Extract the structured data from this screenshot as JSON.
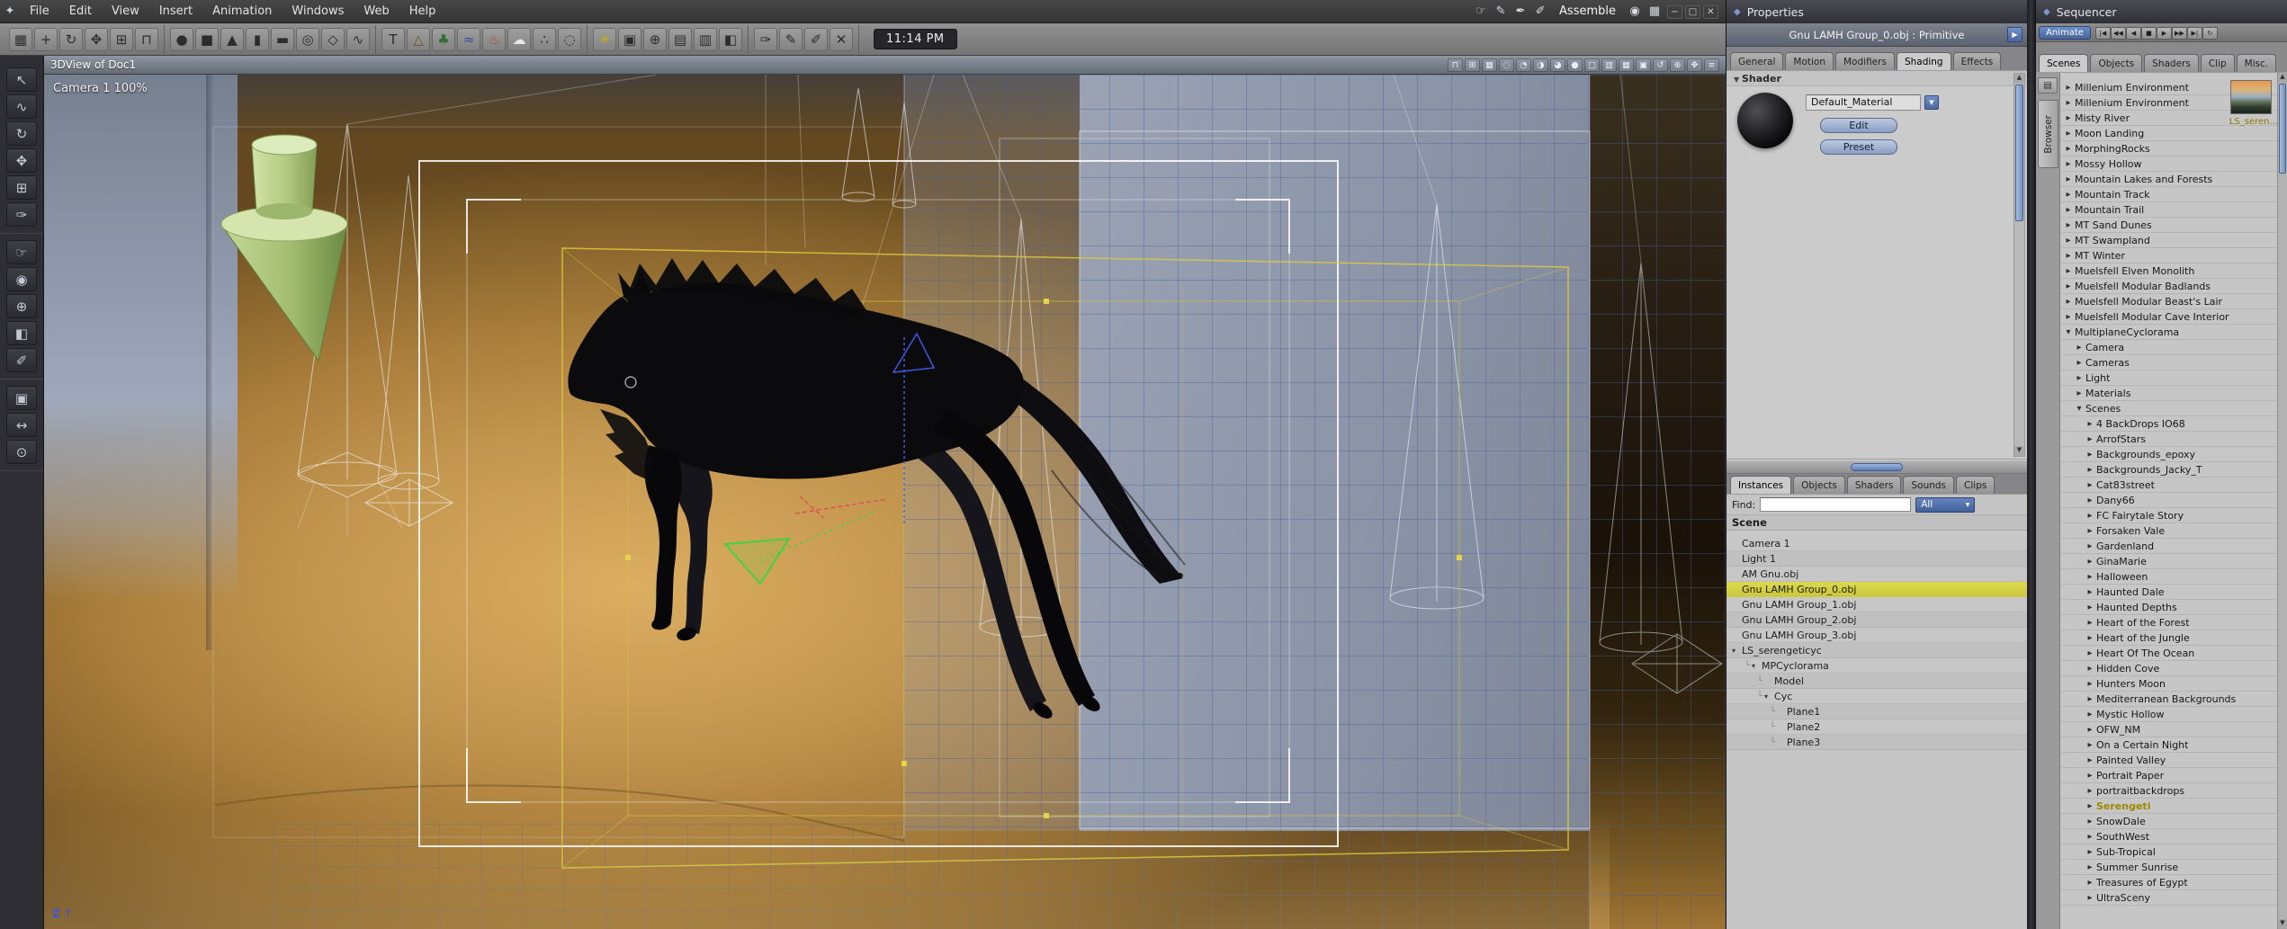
{
  "colors": {
    "accent_blue": "#4a66a0",
    "selection_yellow": "#d5d145",
    "backdrop_orange": "#c2954e",
    "wall_blue": "#8a92a6",
    "highlight_text_yellow": "#9c8a00"
  },
  "menu": {
    "items": [
      "File",
      "Edit",
      "View",
      "Insert",
      "Animation",
      "Windows",
      "Web",
      "Help"
    ],
    "mode_label": "Assemble",
    "left_icons": [
      {
        "name": "app-logo-icon",
        "glyph": "✦"
      }
    ],
    "right_icons": [
      {
        "name": "hand-mode-icon",
        "glyph": "☞"
      },
      {
        "name": "pencil-mode-icon",
        "glyph": "✎"
      },
      {
        "name": "pen-mode-icon",
        "glyph": "✒"
      },
      {
        "name": "brush-mode-icon",
        "glyph": "✐"
      }
    ],
    "right_icons2": [
      {
        "name": "visibility-icon",
        "glyph": "◉"
      },
      {
        "name": "layout-icon",
        "glyph": "▦"
      }
    ],
    "window_controls": [
      {
        "name": "minimize-button",
        "glyph": "−"
      },
      {
        "name": "maximize-button",
        "glyph": "□"
      },
      {
        "name": "close-button",
        "glyph": "✕"
      }
    ]
  },
  "toolbar": {
    "time": "11:14 PM",
    "groups": [
      [
        {
          "name": "grid-plane-icon",
          "glyph": "▦"
        },
        {
          "name": "axes-icon",
          "glyph": "+"
        },
        {
          "name": "rotate-icon",
          "glyph": "↻"
        },
        {
          "name": "move-icon",
          "glyph": "✥"
        },
        {
          "name": "scale-icon",
          "glyph": "⊞"
        },
        {
          "name": "magnet-icon",
          "glyph": "⊓"
        }
      ],
      [
        {
          "name": "insert-sphere-icon",
          "glyph": "●"
        },
        {
          "name": "insert-cube-icon",
          "glyph": "■"
        },
        {
          "name": "insert-cone-icon",
          "glyph": "▲"
        },
        {
          "name": "insert-cylinder-icon",
          "glyph": "▮"
        },
        {
          "name": "insert-plane-icon",
          "glyph": "▬"
        },
        {
          "name": "insert-torus-icon",
          "glyph": "◎"
        },
        {
          "name": "insert-vertex-object-icon",
          "glyph": "◇"
        },
        {
          "name": "insert-spline-object-icon",
          "glyph": "∿"
        }
      ],
      [
        {
          "name": "insert-text-icon",
          "glyph": "T"
        },
        {
          "name": "insert-terrain-icon",
          "glyph": "△",
          "color": "#6e5428"
        },
        {
          "name": "insert-plant-icon",
          "glyph": "♣",
          "color": "#2e6e2e"
        },
        {
          "name": "insert-ocean-icon",
          "glyph": "≈",
          "color": "#2e4e9e"
        },
        {
          "name": "insert-fire-icon",
          "glyph": "♨",
          "color": "#b04a1a"
        },
        {
          "name": "insert-cloud-icon",
          "glyph": "☁",
          "color": "#e8e8e8"
        },
        {
          "name": "insert-particles-icon",
          "glyph": "∴"
        },
        {
          "name": "insert-metaball-icon",
          "glyph": "◌"
        }
      ],
      [
        {
          "name": "insert-light-icon",
          "glyph": "☀",
          "color": "#c8a818"
        },
        {
          "name": "insert-camera-icon",
          "glyph": "▣"
        },
        {
          "name": "insert-target-icon",
          "glyph": "⊕"
        },
        {
          "name": "group-icon",
          "glyph": "▤"
        },
        {
          "name": "ungroup-icon",
          "glyph": "▥"
        },
        {
          "name": "render-icon",
          "glyph": "◧"
        }
      ],
      [
        {
          "name": "eyedropper-icon",
          "glyph": "✑"
        },
        {
          "name": "pencil-icon",
          "glyph": "✎"
        },
        {
          "name": "brush-icon",
          "glyph": "✐"
        },
        {
          "name": "delete-icon",
          "glyph": "✕"
        }
      ]
    ]
  },
  "left_toolbar": {
    "groups": [
      [
        {
          "name": "select-tool",
          "glyph": "↖"
        },
        {
          "name": "lasso-tool",
          "glyph": "∿"
        },
        {
          "name": "rotate-tool",
          "glyph": "↻"
        },
        {
          "name": "move-tool",
          "glyph": "✥"
        },
        {
          "name": "scale-tool",
          "glyph": "⊞"
        },
        {
          "name": "eyedropper-tool",
          "glyph": "✑"
        }
      ],
      [
        {
          "name": "hand-tool",
          "glyph": "☞"
        },
        {
          "name": "bucket-tool",
          "glyph": "◉"
        },
        {
          "name": "magnify-tool",
          "glyph": "⊕"
        },
        {
          "name": "crop-tool",
          "glyph": "◧"
        },
        {
          "name": "brush-tool",
          "glyph": "✐"
        }
      ],
      [
        {
          "name": "camera-track-tool",
          "glyph": "▣"
        },
        {
          "name": "camera-pan-tool",
          "glyph": "↔"
        },
        {
          "name": "camera-zoom-tool",
          "glyph": "⊙"
        }
      ]
    ]
  },
  "viewport": {
    "title": "3DView of Doc1",
    "camera_label": "Camera 1 100%",
    "axis_label": "Z",
    "titlebar_icons": [
      {
        "name": "magnet-icon",
        "glyph": "⊓"
      },
      {
        "name": "grid-snap-icon",
        "glyph": "⊞"
      },
      {
        "name": "grid-icon",
        "glyph": "▦"
      },
      {
        "name": "wireframe-mode-icon",
        "glyph": "◌"
      },
      {
        "name": "lit-wireframe-mode-icon",
        "glyph": "◔"
      },
      {
        "name": "flat-shading-mode-icon",
        "glyph": "◑"
      },
      {
        "name": "smooth-shading-mode-icon",
        "glyph": "◕"
      },
      {
        "name": "textured-mode-icon",
        "glyph": "●"
      },
      {
        "name": "layout-single-icon",
        "glyph": "□"
      },
      {
        "name": "layout-split-icon",
        "glyph": "▥"
      },
      {
        "name": "layout-quad-icon",
        "glyph": "▦"
      },
      {
        "name": "camera-view-icon",
        "glyph": "▣"
      },
      {
        "name": "reset-view-icon",
        "glyph": "↺"
      },
      {
        "name": "zoom-view-icon",
        "glyph": "⊕"
      },
      {
        "name": "pan-view-icon",
        "glyph": "✥"
      },
      {
        "name": "viewport-options-icon",
        "glyph": "≡"
      }
    ]
  },
  "properties": {
    "title": "Properties",
    "subtitle": "Gnu LAMH Group_0.obj : Primitive",
    "tabs": [
      "General",
      "Motion",
      "Modifiers",
      "Shading",
      "Effects"
    ],
    "active_tab": "Shading",
    "shader_section": "Shader",
    "material_name": "Default_Material",
    "edit_button": "Edit",
    "preset_button": "Preset"
  },
  "instances": {
    "tabs": [
      "Instances",
      "Objects",
      "Shaders",
      "Sounds",
      "Clips"
    ],
    "active_tab": "Instances",
    "find_label": "Find:",
    "find_value": "",
    "filter_value": "All",
    "root": "Scene",
    "items": [
      {
        "label": "Camera 1",
        "indent": 0
      },
      {
        "label": "Light 1",
        "indent": 0
      },
      {
        "label": "AM Gnu.obj",
        "indent": 0
      },
      {
        "label": "Gnu LAMH Group_0.obj",
        "indent": 0,
        "selected": true
      },
      {
        "label": "Gnu LAMH Group_1.obj",
        "indent": 0
      },
      {
        "label": "Gnu LAMH Group_2.obj",
        "indent": 0
      },
      {
        "label": "Gnu LAMH Group_3.obj",
        "indent": 0
      },
      {
        "label": "LS_serengeticyc",
        "indent": 0,
        "expander": true
      },
      {
        "label": "MPCyclorama",
        "indent": 1,
        "expander": true
      },
      {
        "label": "Model",
        "indent": 2
      },
      {
        "label": "Cyc",
        "indent": 2,
        "expander": true
      },
      {
        "label": "Plane1",
        "indent": 3
      },
      {
        "label": "Plane2",
        "indent": 3
      },
      {
        "label": "Plane3",
        "indent": 3
      }
    ]
  },
  "sequencer": {
    "title": "Sequencer",
    "animate_button": "Animate",
    "tabs": [
      "Scenes",
      "Objects",
      "Shaders",
      "Clip",
      "Misc."
    ],
    "active_tab": "Scenes",
    "browser_tab": "Browser",
    "thumbnail_label": "LS_seren...",
    "transport": [
      {
        "name": "jump-start-button",
        "glyph": "|◀"
      },
      {
        "name": "prev-frame-button",
        "glyph": "◀◀"
      },
      {
        "name": "play-reverse-button",
        "glyph": "◀"
      },
      {
        "name": "stop-button",
        "glyph": "■"
      },
      {
        "name": "play-button",
        "glyph": "▶"
      },
      {
        "name": "next-frame-button",
        "glyph": "▶▶"
      },
      {
        "name": "jump-end-button",
        "glyph": "▶|"
      },
      {
        "name": "loop-button",
        "glyph": "↻"
      }
    ],
    "items": [
      {
        "label": "Millenium Environment",
        "level": 0
      },
      {
        "label": "Millenium Environment",
        "level": 0
      },
      {
        "label": "Misty River",
        "level": 0
      },
      {
        "label": "Moon Landing",
        "level": 0
      },
      {
        "label": "MorphingRocks",
        "level": 0
      },
      {
        "label": "Mossy Hollow",
        "level": 0
      },
      {
        "label": "Mountain Lakes and Forests",
        "level": 0
      },
      {
        "label": "Mountain Track",
        "level": 0
      },
      {
        "label": "Mountain Trail",
        "level": 0
      },
      {
        "label": "MT Sand Dunes",
        "level": 0
      },
      {
        "label": "MT Swampland",
        "level": 0
      },
      {
        "label": "MT Winter",
        "level": 0
      },
      {
        "label": "Muelsfell Elven Monolith",
        "level": 0
      },
      {
        "label": "Muelsfell Modular Badlands",
        "level": 0
      },
      {
        "label": "Muelsfell Modular Beast's Lair",
        "level": 0
      },
      {
        "label": "Muelsfell Modular Cave Interior",
        "level": 0
      },
      {
        "label": "MultiplaneCyclorama",
        "level": 0,
        "expanded": true
      },
      {
        "label": "Camera",
        "level": 1
      },
      {
        "label": "Cameras",
        "level": 1
      },
      {
        "label": "Light",
        "level": 1
      },
      {
        "label": "Materials",
        "level": 1
      },
      {
        "label": "Scenes",
        "level": 1,
        "expanded": true
      },
      {
        "label": "4 BackDrops IO68",
        "level": 2
      },
      {
        "label": "ArrofStars",
        "level": 2
      },
      {
        "label": "Backgrounds_epoxy",
        "level": 2
      },
      {
        "label": "Backgrounds_Jacky_T",
        "level": 2
      },
      {
        "label": "Cat83street",
        "level": 2
      },
      {
        "label": "Dany66",
        "level": 2
      },
      {
        "label": "FC Fairytale Story",
        "level": 2
      },
      {
        "label": "Forsaken Vale",
        "level": 2
      },
      {
        "label": "Gardenland",
        "level": 2
      },
      {
        "label": "GinaMarie",
        "level": 2
      },
      {
        "label": "Halloween",
        "level": 2
      },
      {
        "label": "Haunted Dale",
        "level": 2
      },
      {
        "label": "Haunted Depths",
        "level": 2
      },
      {
        "label": "Heart of the Forest",
        "level": 2
      },
      {
        "label": "Heart of the Jungle",
        "level": 2
      },
      {
        "label": "Heart Of The Ocean",
        "level": 2
      },
      {
        "label": "Hidden Cove",
        "level": 2
      },
      {
        "label": "Hunters Moon",
        "level": 2
      },
      {
        "label": "Mediterranean Backgrounds",
        "level": 2
      },
      {
        "label": "Mystic Hollow",
        "level": 2
      },
      {
        "label": "OFW_NM",
        "level": 2
      },
      {
        "label": "On a Certain Night",
        "level": 2
      },
      {
        "label": "Painted Valley",
        "level": 2
      },
      {
        "label": "Portrait Paper",
        "level": 2
      },
      {
        "label": "portraitbackdrops",
        "level": 2
      },
      {
        "label": "Serengeti",
        "level": 2,
        "selected": true
      },
      {
        "label": "SnowDale",
        "level": 2
      },
      {
        "label": "SouthWest",
        "level": 2
      },
      {
        "label": "Sub-Tropical",
        "level": 2
      },
      {
        "label": "Summer Sunrise",
        "level": 2
      },
      {
        "label": "Treasures of Egypt",
        "level": 2
      },
      {
        "label": "UltraSceny",
        "level": 2
      }
    ]
  }
}
